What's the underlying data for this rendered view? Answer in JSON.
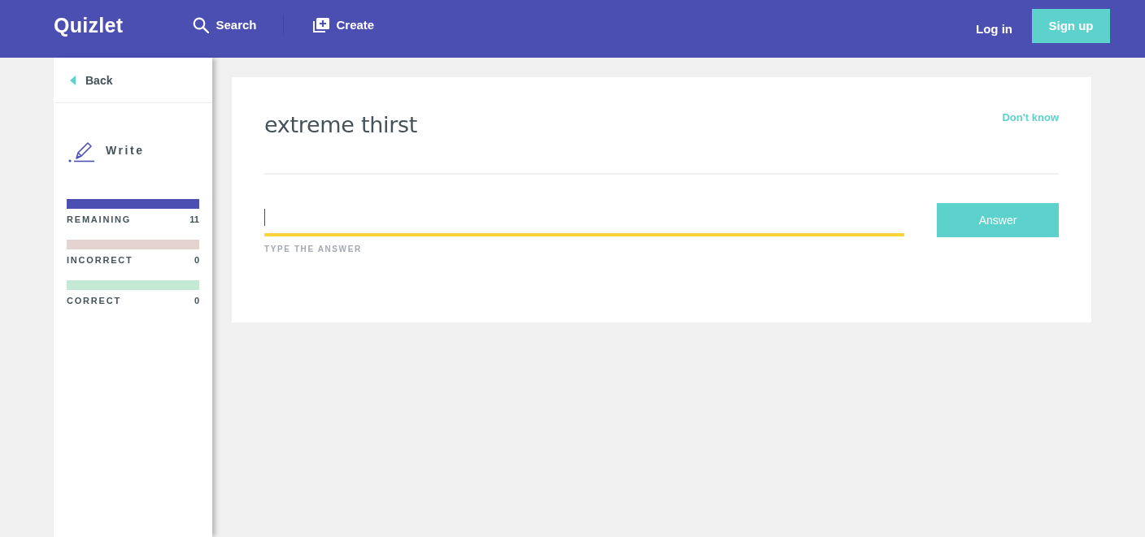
{
  "header": {
    "logo": "Quizlet",
    "nav": [
      {
        "label": "Search",
        "kind": "search"
      },
      {
        "label": "Create",
        "kind": "create"
      }
    ],
    "login": "Log in",
    "signup": "Sign up"
  },
  "sidebar": {
    "back": "Back",
    "mode": "Write",
    "stats": [
      {
        "label": "REMAINING",
        "count": "11",
        "color": "#4b4fb2"
      },
      {
        "label": "INCORRECT",
        "count": "0",
        "color": "#e4d3d0"
      },
      {
        "label": "CORRECT",
        "count": "0",
        "color": "#c4ead6"
      }
    ]
  },
  "question": {
    "term": "extreme thirst",
    "dont_know": "Don't know",
    "answer_field": {
      "focused": true,
      "label": "TYPE THE ANSWER"
    },
    "answer_button": "Answer"
  }
}
